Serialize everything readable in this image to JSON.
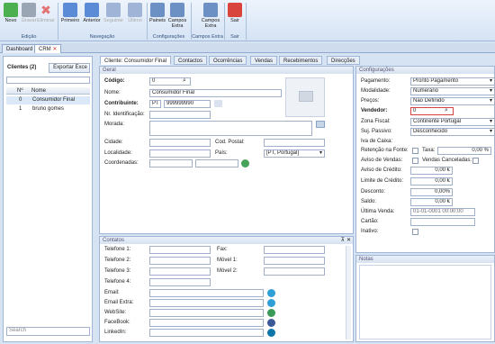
{
  "ribbon": {
    "buttons": [
      {
        "label": "Novo",
        "disabled": false,
        "color": "#4caf50"
      },
      {
        "label": "Gravar",
        "disabled": true,
        "color": "#9aa6b4"
      },
      {
        "label": "Eliminar",
        "disabled": true,
        "color": "#e57373"
      },
      {
        "label": "Primeiro",
        "disabled": false,
        "color": "#5b8bd6"
      },
      {
        "label": "Anterior",
        "disabled": false,
        "color": "#5b8bd6"
      },
      {
        "label": "Seguinte",
        "disabled": true,
        "color": "#9fb4d6"
      },
      {
        "label": "Último",
        "disabled": true,
        "color": "#9fb4d6"
      },
      {
        "label": "Paineis",
        "disabled": false,
        "color": "#6c8fc4"
      },
      {
        "label": "Campos Extra",
        "disabled": false,
        "color": "#6c8fc4"
      },
      {
        "label": "Campos Extra",
        "disabled": false,
        "color": "#6c8fc4"
      },
      {
        "label": "Sair",
        "disabled": false,
        "color": "#d9453d"
      }
    ],
    "groups": [
      "Edição",
      "Navegação",
      "Configurações",
      "Campos Extra",
      "Sair"
    ]
  },
  "doc_tabs": [
    "Dashboard",
    "CRM"
  ],
  "left": {
    "clients_label": "Clientes (2)",
    "export_button": "Exportar Exce",
    "columns": [
      "Nº",
      "Nome"
    ],
    "rows": [
      [
        "0",
        "Consumidor Final"
      ],
      [
        "1",
        "bruno gomes"
      ]
    ],
    "search_placeholder": "Search"
  },
  "client_tabs": [
    "Cliente: Consumidor Final",
    "Contactos",
    "Ocorrências",
    "Vendas",
    "Recebimentos",
    "Direcções"
  ],
  "geral": {
    "title": "Geral",
    "codigo_label": "Código:",
    "codigo": "0",
    "nome_label": "Nome:",
    "nome": "Consumidor Final",
    "contribuinte_label": "Contribuinte:",
    "pais_code": "PT",
    "contribuinte": "999999990",
    "nr_ident_label": "Nr. Identificação:",
    "morada_label": "Morada:",
    "cidade_label": "Cidade:",
    "cod_postal_label": "Cod. Postal:",
    "localidade_label": "Localidade:",
    "pais_label": "País:",
    "pais": "[PT, Portugal]",
    "coordenadas_label": "Coordenadas:"
  },
  "contactos": {
    "title": "Contatos",
    "labels": [
      "Telefone 1:",
      "Telefone 2:",
      "Telefone 3:",
      "Telefone 4:",
      "Email:",
      "Email Extra:",
      "WebSite:",
      "FaceBook:",
      "LinkedIn:"
    ],
    "right_labels": [
      "Fax:",
      "Móvel 1:",
      "Móvel 2:"
    ]
  },
  "config": {
    "title": "Configurações",
    "pagamento_label": "Pagamento:",
    "pagamento": "Pronto Pagamento",
    "modalidade_label": "Modalidade:",
    "modalidade": "Numerário",
    "precos_label": "Preços:",
    "precos": "Não Definido",
    "vendedor_label": "Vendedor:",
    "vendedor": "0",
    "zona_label": "Zona Fiscal:",
    "zona": "Continente Portugal",
    "suj_label": "Suj. Passivo:",
    "suj": "Desconhecido",
    "iva_label": "Iva de Caixa:",
    "retencao_label": "Retenção na Fonte:",
    "taxa_label": "Taxa:",
    "taxa": "0,00 %",
    "aviso_vendas_label": "Aviso de Vendas:",
    "vendas_canceladas_label": "Vendas Canceladas:",
    "aviso_credito_label": "Aviso de Crédito:",
    "aviso_credito": "0,00 €",
    "limite_label": "Limite de Crédito:",
    "limite": "0,00 €",
    "desconto_label": "Desconto:",
    "desconto": "0,00%",
    "saldo_label": "Saldo:",
    "saldo": "0,00 €",
    "ultima_label": "Última Venda:",
    "ultima": "01-01-0001 00:00:00",
    "cartao_label": "Cartão:",
    "inativo_label": "Inativo:"
  },
  "notas_title": "Notas"
}
